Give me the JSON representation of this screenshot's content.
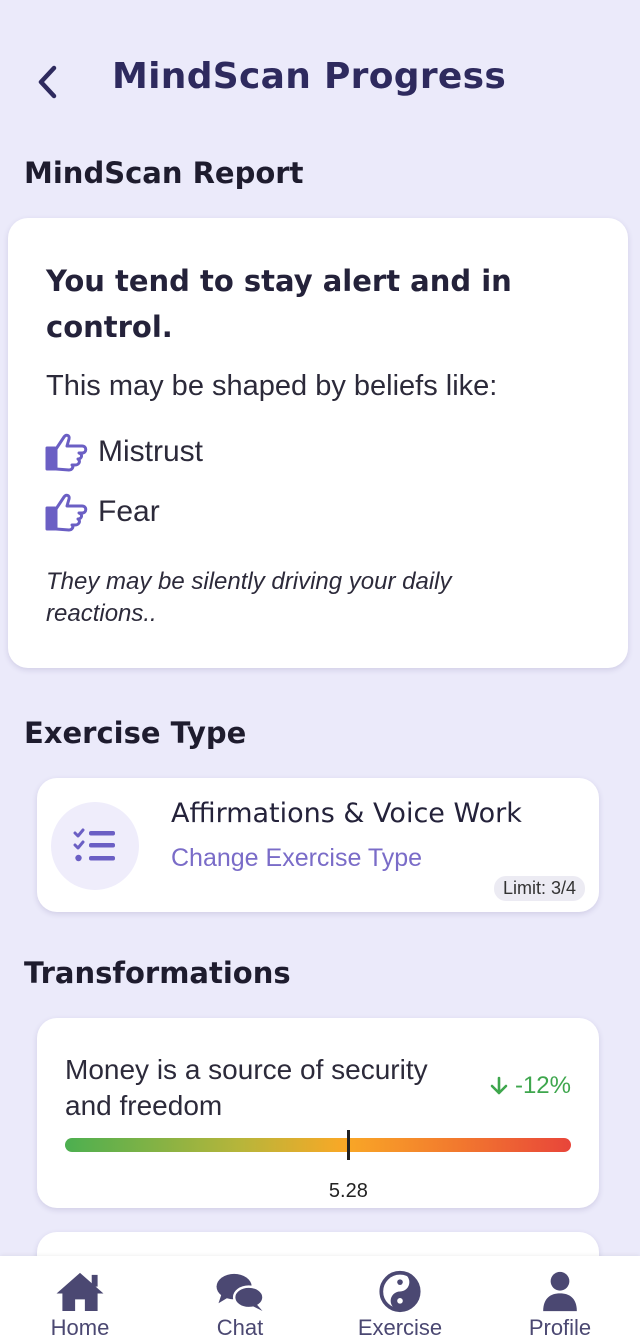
{
  "header": {
    "title": "MindScan Progress",
    "back_icon": "chevron-left-icon"
  },
  "report": {
    "section_title": "MindScan Report",
    "headline": "You tend to stay alert and in control.",
    "subtitle": "This may be shaped by beliefs like:",
    "beliefs": [
      {
        "label": "Mistrust",
        "icon": "pointing-hand-icon"
      },
      {
        "label": "Fear",
        "icon": "pointing-hand-icon"
      }
    ],
    "note": "They may be silently driving your daily reactions.."
  },
  "exercise": {
    "section_title": "Exercise Type",
    "name": "Affirmations & Voice Work",
    "change_label": "Change Exercise Type",
    "limit": "Limit: 3/4",
    "icon": "checklist-icon"
  },
  "transformations": {
    "section_title": "Transformations",
    "items": [
      {
        "belief": "Money is a source of security and freedom",
        "change": "-12%",
        "score": "5.28",
        "score_fraction": 0.56
      }
    ]
  },
  "nav": {
    "items": [
      {
        "label": "Home",
        "icon": "home-icon"
      },
      {
        "label": "Chat",
        "icon": "chat-icon"
      },
      {
        "label": "Exercise",
        "icon": "yin-yang-icon"
      },
      {
        "label": "Profile",
        "icon": "profile-icon"
      }
    ]
  },
  "colors": {
    "accent": "#6b5fc4",
    "background": "#ebeafa",
    "positive": "#3ea64d",
    "title": "#2e2a5e"
  }
}
